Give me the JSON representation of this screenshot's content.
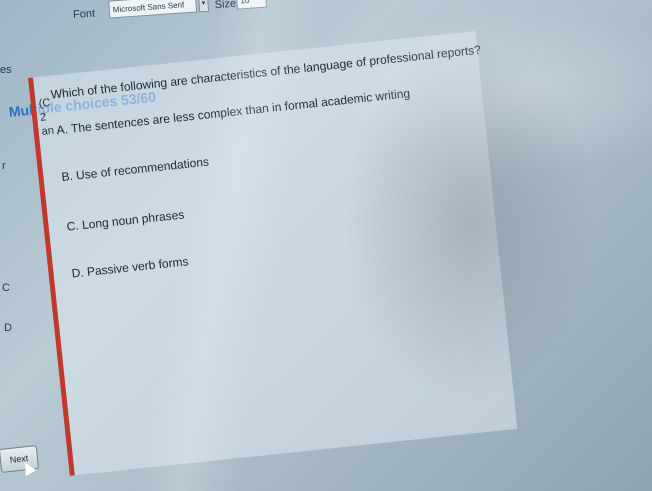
{
  "toolbar": {
    "font_label": "Font",
    "font_value": "Microsoft Sans Serif",
    "size_label": "Size",
    "size_value": "10"
  },
  "left_edge": {
    "labels": [
      "es",
      "r",
      "C",
      "D"
    ]
  },
  "quiz": {
    "heading": "Multiple choices 53/60",
    "question_prefix": "(C",
    "question_num": "2",
    "question_suffix": "an",
    "question": "Which of the following are characteristics of the language of professional reports?",
    "options": [
      {
        "letter": "A.",
        "text": "The sentences are less complex than in formal academic writing"
      },
      {
        "letter": "B.",
        "text": "Use of recommendations"
      },
      {
        "letter": "C.",
        "text": "Long noun phrases"
      },
      {
        "letter": "D.",
        "text": "Passive verb forms"
      }
    ],
    "next_label": "Next"
  }
}
